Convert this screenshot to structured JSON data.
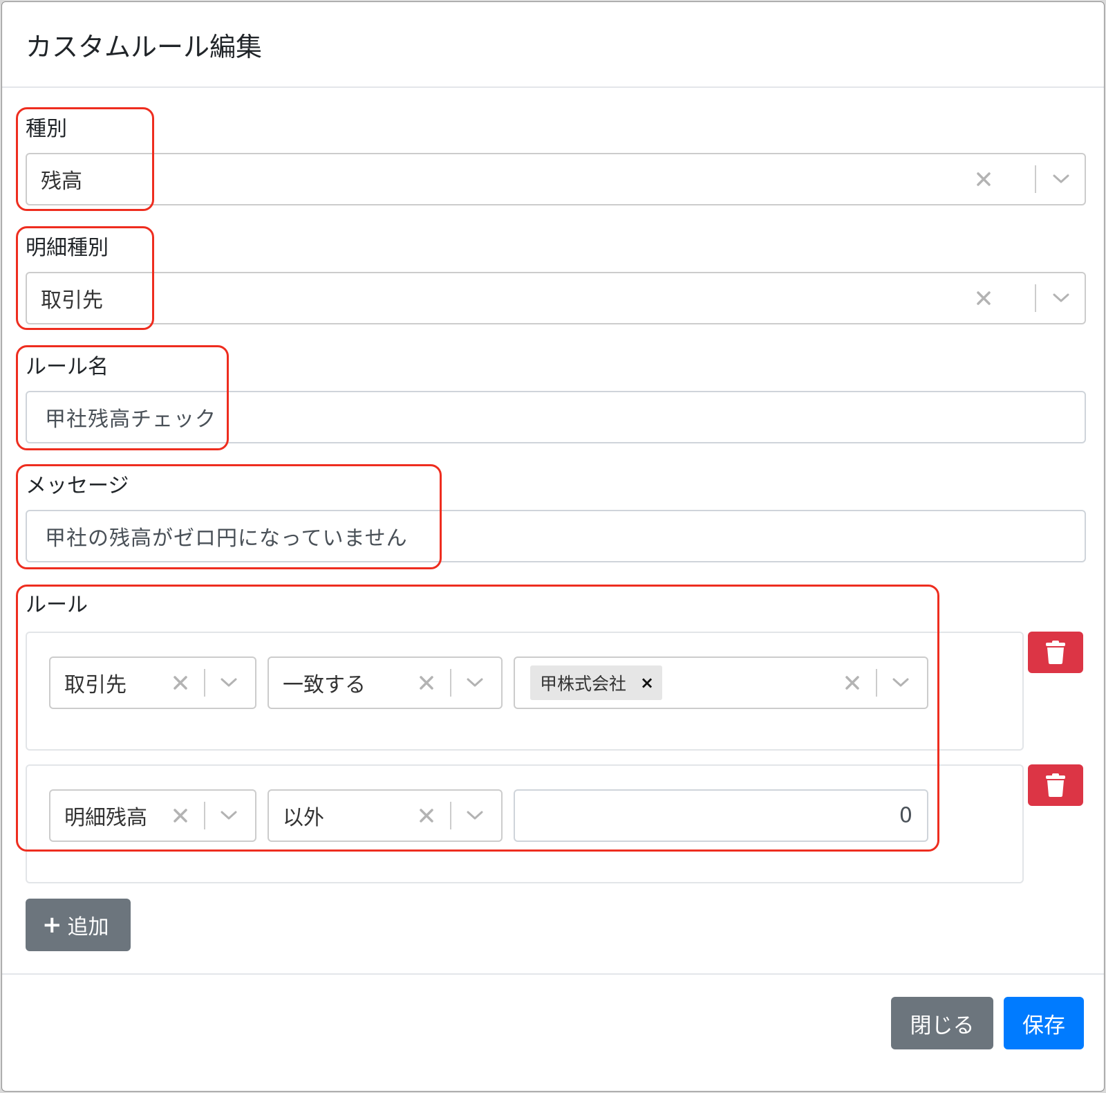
{
  "modal": {
    "title": "カスタムルール編集"
  },
  "type_field": {
    "label": "種別",
    "value": "残高"
  },
  "detail_type_field": {
    "label": "明細種別",
    "value": "取引先"
  },
  "rule_name_field": {
    "label": "ルール名",
    "value": "甲社残高チェック"
  },
  "message_field": {
    "label": "メッセージ",
    "value": "甲社の残高がゼロ円になっていません"
  },
  "rules_section": {
    "label": "ルール",
    "rules": [
      {
        "target": "取引先",
        "operator": "一致する",
        "value_chips": [
          "甲株式会社"
        ]
      },
      {
        "target": "明細残高",
        "operator": "以外",
        "value": "0"
      }
    ],
    "add_button_label": "追加"
  },
  "footer": {
    "close_label": "閉じる",
    "save_label": "保存"
  },
  "colors": {
    "primary": "#007bff",
    "secondary": "#6c757d",
    "danger": "#dc3545",
    "annotation": "#ee2d1f"
  },
  "icons": {
    "clear": "close-icon",
    "dropdown": "chevron-down-icon",
    "delete": "trash-icon",
    "add": "plus-icon"
  }
}
